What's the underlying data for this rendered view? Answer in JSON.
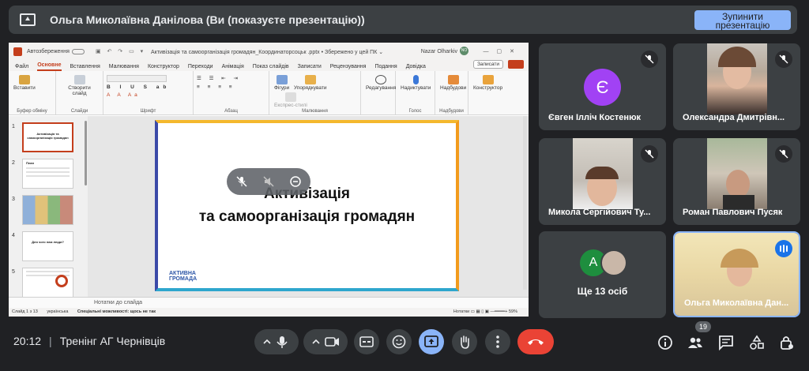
{
  "topbar": {
    "title": "Ольга Миколаївна Данілова (Ви (показуєте презентацію))",
    "stop_button": "Зупинити презентацію"
  },
  "powerpoint": {
    "autosave_label": "Автозбереження",
    "doc_title": "Активізація та самоорганізація громадян_Координаторсоцьк .pptx • Збережено у цей ПК ⌄",
    "user_name": "Nazar Olharkiv",
    "user_initials": "NO",
    "tabs": [
      "Файл",
      "Основне",
      "Вставлення",
      "Малювання",
      "Конструктор",
      "Переходи",
      "Анімація",
      "Показ слайдів",
      "Записати",
      "Рецензування",
      "Подання",
      "Довідка"
    ],
    "record_button": "Записати",
    "ribbon_groups": [
      {
        "label": "Буфер обміну",
        "buttons": [
          "Вставити"
        ]
      },
      {
        "label": "Слайди",
        "buttons": [
          "Створити слайд"
        ]
      },
      {
        "label": "Шрифт",
        "buttons": []
      },
      {
        "label": "Абзац",
        "buttons": []
      },
      {
        "label": "Малювання",
        "buttons": [
          "Фігури",
          "Упорядкувати",
          "Експрес-стилі"
        ]
      },
      {
        "label": "",
        "buttons": [
          "Редагування"
        ]
      },
      {
        "label": "Голос",
        "buttons": [
          "Надиктувати"
        ]
      },
      {
        "label": "Надбудови",
        "buttons": [
          "Надбудови"
        ]
      },
      {
        "label": "",
        "buttons": [
          "Конструктор"
        ]
      }
    ],
    "thumbnails": [
      {
        "num": "1",
        "text": "Активізація та самоорганізація громадян"
      },
      {
        "num": "2",
        "text": "План"
      },
      {
        "num": "3",
        "text": ""
      },
      {
        "num": "4",
        "text": "Для чого нам люди?"
      },
      {
        "num": "5",
        "text": ""
      }
    ],
    "slide": {
      "title_line1": "Активізація",
      "title_line2": "та самоорганізація громадян",
      "logo_line1": "АКТИВНА",
      "logo_line2": "ГРОМАДА"
    },
    "notes_placeholder": "Нотатки до слайда",
    "status": {
      "slide": "Слайд 1 з 13",
      "language": "українська",
      "accessibility": "Спеціальні можливості: щось не так",
      "notes": "Нотатки",
      "zoom": "59%"
    }
  },
  "participants": [
    {
      "name": "Євген Ілліч Костенюк",
      "initial": "Є",
      "avatar_color": "#a142f4",
      "muted": true
    },
    {
      "name": "Олександра Дмитрівн...",
      "muted": true
    },
    {
      "name": "Микола Сергійович Ту...",
      "muted": true
    },
    {
      "name": "Роман Павлович Пусяк",
      "muted": true
    },
    {
      "name": "Ще 13 осіб",
      "initial": "A",
      "avatar_color": "#1e8e3e"
    },
    {
      "name": "Ольга Миколаївна Дан...",
      "speaking": true
    }
  ],
  "bottombar": {
    "time": "20:12",
    "meeting_title": "Тренінг АГ Чернівців",
    "participant_count": "19",
    "end_call_color": "#ea4335",
    "present_active_color": "#8ab4f8"
  }
}
